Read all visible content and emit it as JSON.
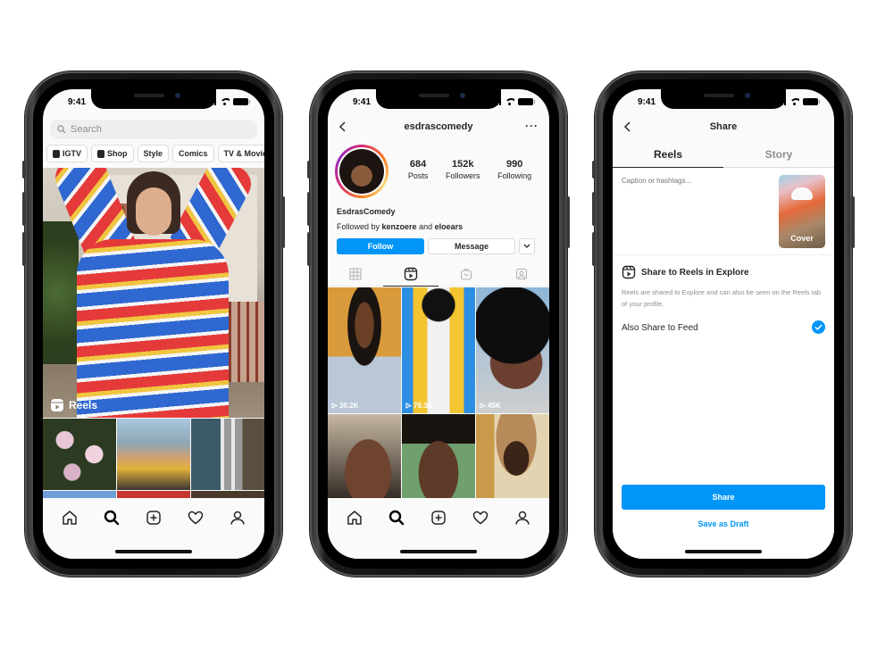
{
  "status_bar": {
    "time": "9:41"
  },
  "phones": {
    "explore": {
      "search_placeholder": "Search",
      "chips": [
        {
          "label": "IGTV",
          "icon": "igtv-icon"
        },
        {
          "label": "Shop",
          "icon": "shop-bag-icon"
        },
        {
          "label": "Style"
        },
        {
          "label": "Comics"
        },
        {
          "label": "TV & Movies"
        }
      ],
      "hero_label": "Reels"
    },
    "profile": {
      "username": "esdrascomedy",
      "display_name": "EsdrasComedy",
      "stats": [
        {
          "value": "684",
          "label": "Posts"
        },
        {
          "value": "152k",
          "label": "Followers"
        },
        {
          "value": "990",
          "label": "Following"
        }
      ],
      "followed_by_prefix": "Followed by",
      "followed_by_user1": "kenzoere",
      "followed_by_and": "and",
      "followed_by_user2": "eloears",
      "follow_button": "Follow",
      "message_button": "Message",
      "tabs": [
        "grid",
        "reels",
        "igtv",
        "tagged"
      ],
      "active_tab": "reels",
      "reels": [
        {
          "views": "30.2K",
          "bg": "#d99a3c"
        },
        {
          "views": "79.3K",
          "bg": "#2d8fe3"
        },
        {
          "views": "45K",
          "bg": "#8fb7d8"
        },
        {
          "views": "",
          "bg": "#c7b8a3"
        },
        {
          "views": "",
          "bg": "#6fa06e"
        },
        {
          "views": "",
          "bg": "#c89a4a"
        }
      ]
    },
    "share": {
      "title": "Share",
      "tabs": [
        {
          "label": "Reels",
          "active": true
        },
        {
          "label": "Story",
          "active": false
        }
      ],
      "caption_placeholder": "Caption or hashtags...",
      "cover_label": "Cover",
      "explore_title": "Share to Reels in Explore",
      "explore_desc": "Reels are shared to Explore and can also be seen on the Reels tab of your profile.",
      "also_share_label": "Also Share to Feed",
      "also_share_checked": true,
      "share_button": "Share",
      "draft_button": "Save as Draft"
    }
  },
  "colors": {
    "accent": "#0095f6",
    "text": "#262626",
    "muted": "#8e8e8e"
  }
}
